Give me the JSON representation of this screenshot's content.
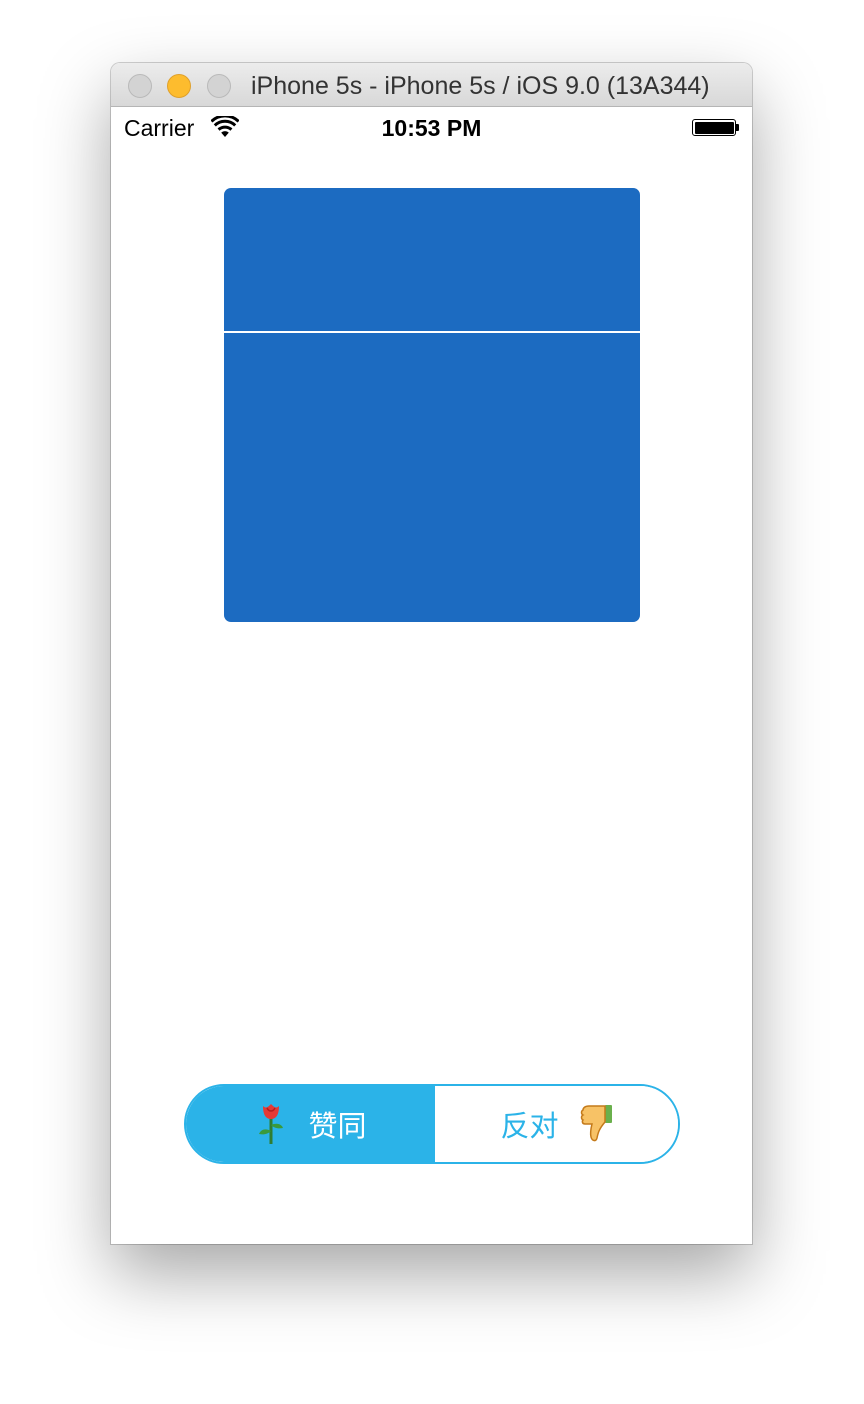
{
  "window": {
    "title": "iPhone 5s - iPhone 5s / iOS 9.0 (13A344)"
  },
  "status_bar": {
    "carrier": "Carrier",
    "time": "10:53 PM",
    "wifi_icon": "wifi-icon",
    "battery_icon": "battery-full-icon"
  },
  "card": {
    "color": "#1c6bc1"
  },
  "vote": {
    "agree_label": "赞同",
    "agree_icon": "rose-icon",
    "oppose_label": "反对",
    "oppose_icon": "thumbs-down-icon",
    "selected": "agree",
    "accent_color": "#2bb3e8"
  }
}
